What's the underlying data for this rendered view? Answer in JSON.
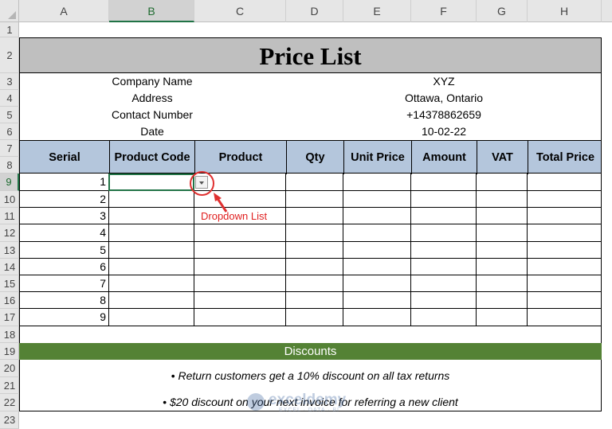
{
  "columns": [
    "A",
    "B",
    "C",
    "D",
    "E",
    "F",
    "G",
    "H"
  ],
  "rows": [
    "1",
    "2",
    "3",
    "4",
    "5",
    "6",
    "7",
    "8",
    "9",
    "10",
    "11",
    "12",
    "13",
    "14",
    "15",
    "16",
    "17",
    "18",
    "19",
    "20",
    "21",
    "22",
    "23"
  ],
  "title": "Price List",
  "info": [
    {
      "label": "Company Name",
      "value": "XYZ"
    },
    {
      "label": "Address",
      "value": "Ottawa, Ontario"
    },
    {
      "label": "Contact Number",
      "value": "+14378862659"
    },
    {
      "label": "Date",
      "value": "10-02-22"
    }
  ],
  "headers": [
    "Serial",
    "Product Code",
    "Product",
    "Qty",
    "Unit Price",
    "Amount",
    "VAT",
    "Total Price"
  ],
  "serials": [
    "1",
    "2",
    "3",
    "4",
    "5",
    "6",
    "7",
    "8",
    "9"
  ],
  "dropdown_note": "Dropdown List",
  "discounts": {
    "title": "Discounts",
    "items": [
      "• Return customers get a 10% discount on all tax returns",
      "• $20 discount on your next invoice for referring a new client"
    ]
  },
  "watermark": {
    "name": "exceldemy",
    "tagline": "EXCEL · DATA · BI"
  },
  "colors": {
    "header_fill": "#b4c6dc",
    "title_fill": "#bfbfbf",
    "discount_fill": "#548235",
    "selection": "#217346",
    "annotation": "#e03030"
  }
}
